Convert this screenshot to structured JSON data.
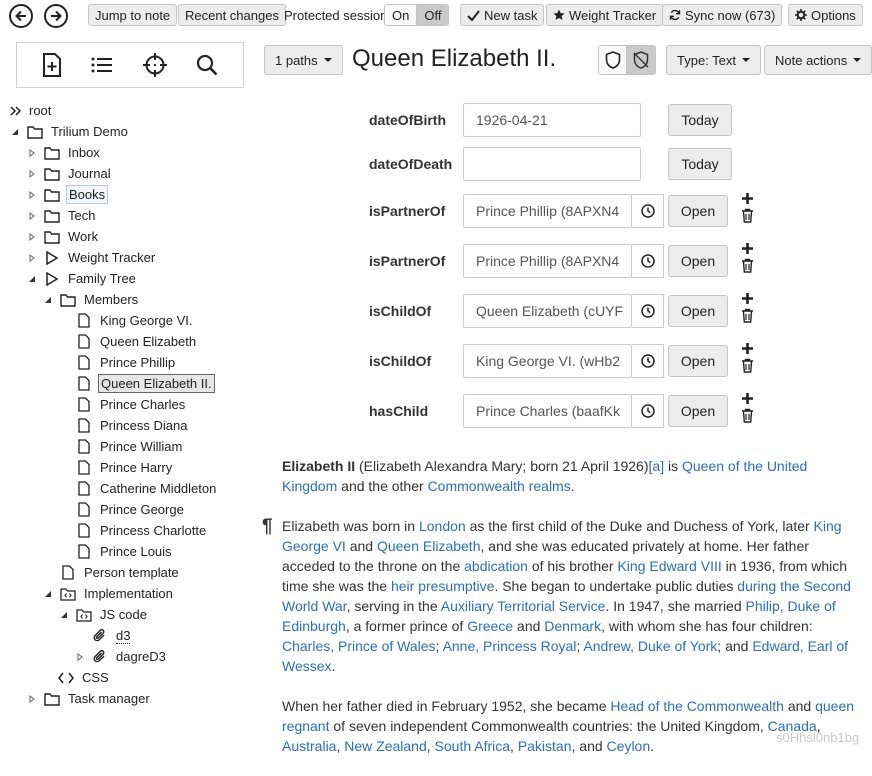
{
  "topbar": {
    "jump_to_note": "Jump to note",
    "recent_changes": "Recent changes",
    "protected_session_label": "Protected session:",
    "on": "On",
    "off": "Off",
    "new_task": "New task",
    "weight_tracker": "Weight Tracker",
    "sync_now": "Sync now (673)",
    "options": "Options"
  },
  "tree": {
    "items": [
      {
        "label": "root"
      },
      {
        "label": "Trilium Demo"
      },
      {
        "label": "Inbox"
      },
      {
        "label": "Journal"
      },
      {
        "label": "Books"
      },
      {
        "label": "Tech"
      },
      {
        "label": "Work"
      },
      {
        "label": "Weight Tracker"
      },
      {
        "label": "Family Tree"
      },
      {
        "label": "Members"
      },
      {
        "label": "King George VI."
      },
      {
        "label": "Queen Elizabeth"
      },
      {
        "label": "Prince Phillip"
      },
      {
        "label": "Queen Elizabeth II."
      },
      {
        "label": "Prince Charles"
      },
      {
        "label": "Princess Diana"
      },
      {
        "label": "Prince William"
      },
      {
        "label": "Prince Harry"
      },
      {
        "label": "Catherine Middleton"
      },
      {
        "label": "Prince George"
      },
      {
        "label": "Princess Charlotte"
      },
      {
        "label": "Prince Louis"
      },
      {
        "label": "Person template"
      },
      {
        "label": "Implementation"
      },
      {
        "label": "JS code"
      },
      {
        "label": "d3"
      },
      {
        "label": "dagreD3"
      },
      {
        "label": "CSS"
      },
      {
        "label": "Task manager"
      }
    ]
  },
  "note": {
    "paths": "1 paths",
    "title": "Queen Elizabeth II.",
    "type": "Type: Text",
    "actions": "Note actions"
  },
  "attributes": [
    {
      "name": "dateOfBirth",
      "value": "1926-04-21",
      "button": "Today"
    },
    {
      "name": "dateOfDeath",
      "value": "",
      "button": "Today"
    },
    {
      "name": "isPartnerOf",
      "value": "Prince Phillip (8APXN4",
      "button": "Open"
    },
    {
      "name": "isPartnerOf",
      "value": "Prince Phillip (8APXN4",
      "button": "Open"
    },
    {
      "name": "isChildOf",
      "value": "Queen Elizabeth (cUYF",
      "button": "Open"
    },
    {
      "name": "isChildOf",
      "value": "King George VI. (wHb2",
      "button": "Open"
    },
    {
      "name": "hasChild",
      "value": "Prince Charles (baafKk",
      "button": "Open"
    }
  ],
  "body": {
    "p1": [
      {
        "t": "Elizabeth II",
        "b": true
      },
      {
        "t": " (Elizabeth Alexandra Mary; born 21 April 1926)"
      },
      {
        "t": "[a]",
        "link": true
      },
      {
        "t": " is "
      },
      {
        "t": "Queen of the United Kingdom",
        "link": true
      },
      {
        "t": " and the other "
      },
      {
        "t": "Commonwealth realms",
        "link": true
      },
      {
        "t": "."
      }
    ],
    "p2": [
      {
        "t": "Elizabeth was born in "
      },
      {
        "t": "London",
        "link": true
      },
      {
        "t": " as the first child of the Duke and Duchess of York, later "
      },
      {
        "t": "King George VI",
        "link": true
      },
      {
        "t": " and "
      },
      {
        "t": "Queen Elizabeth",
        "link": true
      },
      {
        "t": ", and she was educated privately at home. Her father acceded to the throne on the "
      },
      {
        "t": "abdication",
        "link": true
      },
      {
        "t": " of his brother "
      },
      {
        "t": "King Edward VIII",
        "link": true
      },
      {
        "t": " in 1936, from which time she was the "
      },
      {
        "t": "heir presumptive",
        "link": true
      },
      {
        "t": ". She began to undertake public duties "
      },
      {
        "t": "during the Second World War",
        "link": true
      },
      {
        "t": ", serving in the "
      },
      {
        "t": "Auxiliary Territorial Service",
        "link": true
      },
      {
        "t": ". In 1947, she married "
      },
      {
        "t": "Philip, Duke of Edinburgh",
        "link": true
      },
      {
        "t": ", a former prince of "
      },
      {
        "t": "Greece",
        "link": true
      },
      {
        "t": " and "
      },
      {
        "t": "Denmark",
        "link": true
      },
      {
        "t": ", with whom she has four children: "
      },
      {
        "t": "Charles, Prince of Wales",
        "link": true
      },
      {
        "t": "; "
      },
      {
        "t": "Anne, Princess Royal",
        "link": true
      },
      {
        "t": "; "
      },
      {
        "t": "Andrew, Duke of York",
        "link": true
      },
      {
        "t": "; and "
      },
      {
        "t": "Edward, Earl of Wessex",
        "link": true
      },
      {
        "t": "."
      }
    ],
    "p3": [
      {
        "t": "When her father died in February 1952, she became "
      },
      {
        "t": "Head of the Commonwealth",
        "link": true
      },
      {
        "t": " and "
      },
      {
        "t": "queen regnant",
        "link": true
      },
      {
        "t": " of seven independent Commonwealth countries: the United Kingdom, "
      },
      {
        "t": "Canada",
        "link": true
      },
      {
        "t": ", "
      },
      {
        "t": "Australia",
        "link": true
      },
      {
        "t": ", "
      },
      {
        "t": "New Zealand",
        "link": true
      },
      {
        "t": ", "
      },
      {
        "t": "South Africa",
        "link": true
      },
      {
        "t": ", "
      },
      {
        "t": "Pakistan",
        "link": true
      },
      {
        "t": ", and "
      },
      {
        "t": "Ceylon",
        "link": true
      },
      {
        "t": "."
      }
    ]
  },
  "watermark": "s0Hhsl0nb1bg",
  "icons": {
    "back": "arrow-left-icon",
    "forward": "arrow-right-icon",
    "new_note": "new-note-icon",
    "collapse": "list-icon",
    "scroll_to_active": "crosshair-icon",
    "search": "search-icon",
    "protect": "shield-icon",
    "unprotect": "shield-off-icon"
  },
  "colors": {
    "link": "#2a6fb8",
    "button_bg": "#ececec",
    "toggle_off_bg": "#c9c9c9",
    "active_note_bg": "#e6e6e6"
  }
}
